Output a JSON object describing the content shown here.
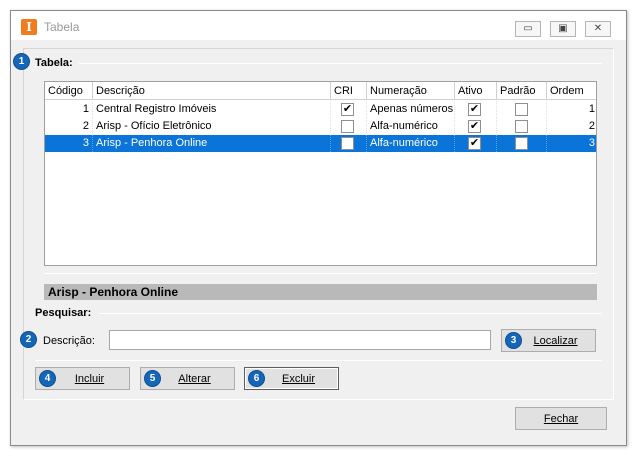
{
  "window": {
    "title": "Tabela",
    "icon": "app-logo-icon",
    "icon_glyph": "I",
    "controls": {
      "minimize": "▭",
      "restore": "▣",
      "close": "✕"
    }
  },
  "table_section": {
    "badge": "1",
    "label": "Tabela:",
    "columns": [
      "Código",
      "Descrição",
      "CRI",
      "Numeração",
      "Ativo",
      "Padrão",
      "Ordem"
    ],
    "rows": [
      {
        "codigo": "1",
        "descricao": "Central Registro Imóveis",
        "cri": true,
        "numeracao": "Apenas números",
        "ativo": true,
        "padrao": false,
        "ordem": "1",
        "selected": false
      },
      {
        "codigo": "2",
        "descricao": "Arisp - Ofício Eletrônico",
        "cri": false,
        "numeracao": "Alfa-numérico",
        "ativo": true,
        "padrao": false,
        "ordem": "2",
        "selected": false
      },
      {
        "codigo": "3",
        "descricao": "Arisp - Penhora Online",
        "cri": false,
        "numeracao": "Alfa-numérico",
        "ativo": true,
        "padrao": false,
        "ordem": "3",
        "selected": true
      }
    ],
    "check_glyph": "✔",
    "selected_description": "Arisp - Penhora Online"
  },
  "search": {
    "label": "Pesquisar:",
    "badge": "2",
    "field_label": "Descrição:",
    "value": "",
    "placeholder": "",
    "button": {
      "badge": "3",
      "label": "Localizar"
    }
  },
  "actions": {
    "incluir": {
      "badge": "4",
      "label": "Incluir"
    },
    "alterar": {
      "badge": "5",
      "label": "Alterar"
    },
    "excluir": {
      "badge": "6",
      "label": "Excluir"
    },
    "fechar": {
      "label": "Fechar"
    }
  },
  "colors": {
    "badge_blue": "#1566b8",
    "selection_blue": "#0a74d8",
    "accent_orange": "#f07c1e",
    "footer_gray": "#b9b9b9"
  }
}
